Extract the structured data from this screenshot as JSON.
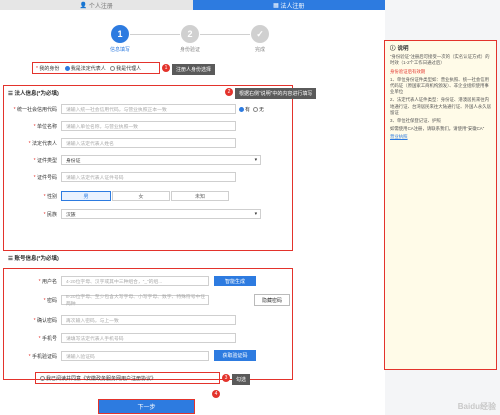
{
  "tabs": {
    "personal": "个人注册",
    "legal": "法人注册"
  },
  "steps": [
    {
      "num": "1",
      "label": "信息填写"
    },
    {
      "num": "2",
      "label": "身份验证"
    },
    {
      "num": "✓",
      "label": "完成"
    }
  ],
  "identity": {
    "label": "我的身份",
    "opt1": "我是法定代表人",
    "opt2": "我是代理人",
    "badge": "1",
    "tip": "注册人身份选择"
  },
  "legal_section": {
    "title": "法人信息(*为必填)",
    "badge": "2",
    "tip": "根据右侧“说明”中的内容进行填写",
    "credit_label": "统一社会信用代码",
    "credit_placeholder": "请输入统一社会信用代码，与营业执照正本一致",
    "credit_yes": "有",
    "credit_no": "无",
    "unit_label": "单位名称",
    "unit_placeholder": "请输入单位名称，与营业执照一致",
    "rep_label": "法定代表人",
    "rep_placeholder": "请输入法定代表人姓名",
    "idtype_label": "证件类型",
    "idtype_value": "身份证",
    "idno_label": "证件号码",
    "idno_placeholder": "请输入法定代表人证件号码",
    "gender_label": "性别",
    "gender_male": "男",
    "gender_female": "女",
    "gender_unknown": "未知",
    "nation_label": "民族",
    "nation_value": "汉族"
  },
  "account_section": {
    "title": "账号信息(*为必填)",
    "user_label": "用户名",
    "user_placeholder": "4-20位字母、汉字或其中三种组合，“_”的组...",
    "user_btn": "智能生成",
    "pwd_label": "密码",
    "pwd_placeholder": "8-20位字母、至少包含大写字母、小写字母、数字、特殊符号中任两种",
    "pwd_btn": "隐藏密码",
    "confirm_label": "确认密码",
    "confirm_placeholder": "再次输入密码，与上一致",
    "phone_label": "手机号",
    "phone_placeholder": "请填写法定代表人手机号码",
    "code_label": "手机验证码",
    "code_placeholder": "请输入验证码",
    "code_btn": "获取验证码"
  },
  "agreement": {
    "text": "我已阅读并同意《安徽政务服务网用户注册协议》",
    "badge": "3",
    "tip": "勾选"
  },
  "next_btn": "下一步",
  "next_badge": "4",
  "sidebar": {
    "title": "说明",
    "p1": "“身份验证”注册后可接受一次的（实名认证方式）的时效（1-2个工作日通过后）",
    "p1_red": "身份验证后有效期",
    "p2": "1、单位身份证件类型如：营业执照、统一社会信用代码证（原国家工商机构颁发）、非企业组织使用事业单位",
    "p3": "2、法定代表人证件类型：身份证、港澳居民来往内地通行证、台湾居民来往大陆通行证、外国人永久居留证",
    "p4": "3、单位社保登记证、护照",
    "p5": "如需使用CA注册，请联系我们。请使用“安徽CA”",
    "link": "营业执照"
  },
  "watermark": "Baidu经验"
}
